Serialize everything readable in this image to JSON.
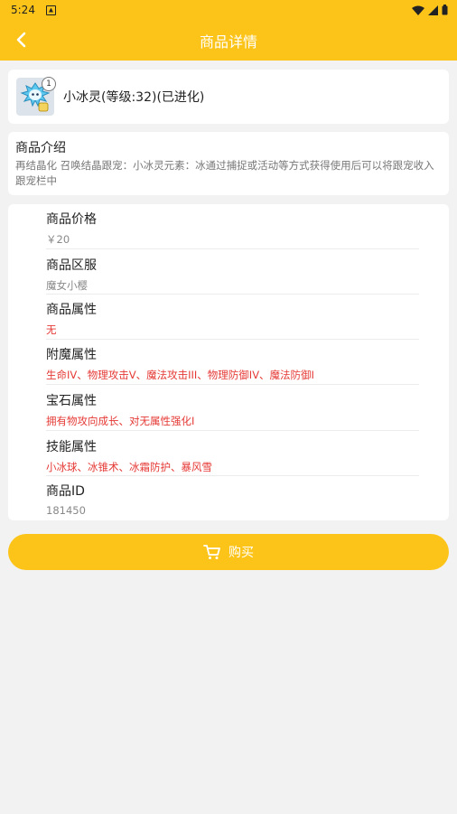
{
  "status_bar": {
    "time": "5:24"
  },
  "header": {
    "title": "商品详情"
  },
  "item": {
    "title": "小冰灵(等级:32)(已进化)",
    "quantity": "1",
    "icon": "ice-spirit-pet-icon"
  },
  "intro": {
    "label": "商品介绍",
    "description": "再结晶化 召唤结晶跟宠：小冰灵元素：冰通过捕捉或活动等方式获得使用后可以将跟宠收入跟宠栏中"
  },
  "attributes": [
    {
      "label": "商品价格",
      "value": "￥20",
      "highlight": false
    },
    {
      "label": "商品区服",
      "value": "魔女小樱",
      "highlight": false
    },
    {
      "label": "商品属性",
      "value": "无",
      "highlight": true
    },
    {
      "label": "附魔属性",
      "value": "生命IV、物理攻击V、魔法攻击III、物理防御IV、魔法防御I",
      "highlight": true
    },
    {
      "label": "宝石属性",
      "value": "拥有物攻向成长、对无属性强化I",
      "highlight": true
    },
    {
      "label": "技能属性",
      "value": "小冰球、冰锥术、冰霜防护、暴风雪",
      "highlight": true
    },
    {
      "label": "商品ID",
      "value": "181450",
      "highlight": false
    }
  ],
  "buy_button": {
    "label": "购买",
    "icon": "cart-icon"
  },
  "colors": {
    "accent": "#fcc419",
    "highlight_text": "#e53935"
  }
}
